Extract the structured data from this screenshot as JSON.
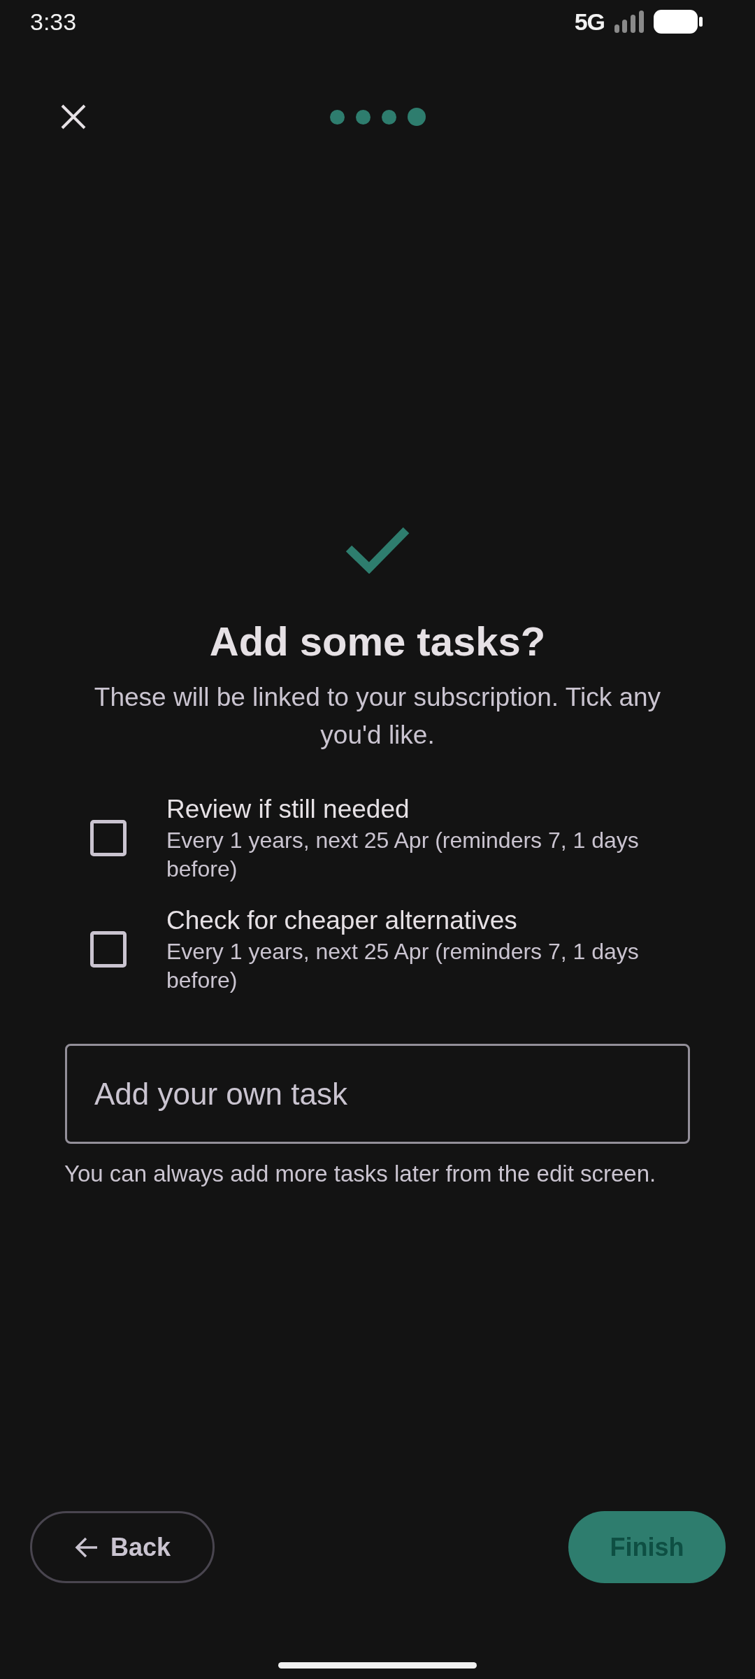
{
  "status_bar": {
    "time": "3:33",
    "network": "5G"
  },
  "progress": {
    "steps": [
      {
        "current": false
      },
      {
        "current": false
      },
      {
        "current": false
      },
      {
        "current": true
      }
    ]
  },
  "header": {
    "title": "Add some tasks?",
    "subtitle": "These will be linked to your subscription. Tick any you'd like."
  },
  "tasks": [
    {
      "title": "Review if still needed",
      "detail": "Every 1 years, next 25 Apr (reminders 7, 1 days before)",
      "checked": false
    },
    {
      "title": "Check for cheaper alternatives",
      "detail": "Every 1 years, next 25 Apr (reminders 7, 1 days before)",
      "checked": false
    }
  ],
  "custom_task": {
    "placeholder": "Add your own task"
  },
  "hint": "You can always add more tasks later from the edit screen.",
  "buttons": {
    "back": "Back",
    "finish": "Finish"
  }
}
